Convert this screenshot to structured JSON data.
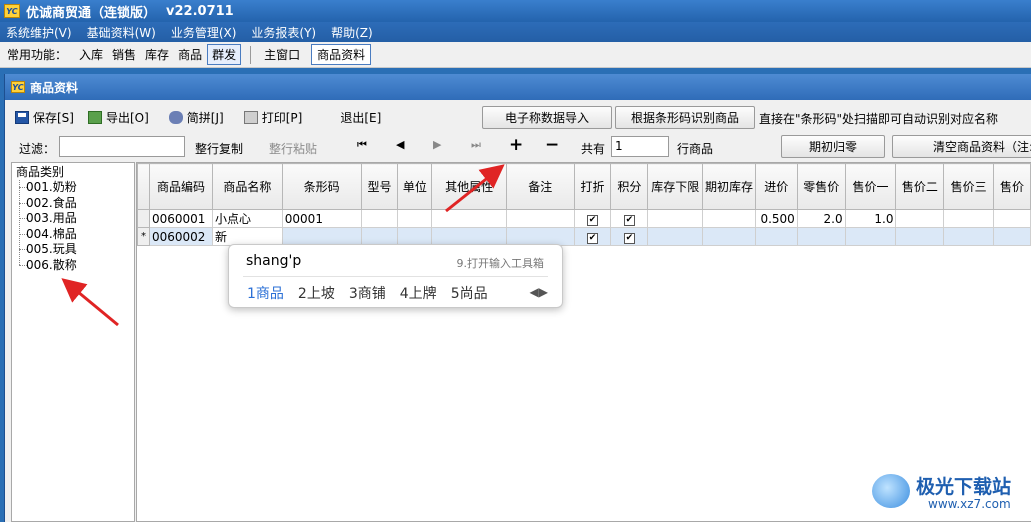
{
  "window": {
    "title": "优诚商贸通（连锁版）",
    "version": "v22.0711"
  },
  "menu": [
    "系统维护(V)",
    "基础资料(W)",
    "业务管理(X)",
    "业务报表(Y)",
    "帮助(Z)"
  ],
  "funcbar": {
    "label": "常用功能：",
    "items": [
      "入库",
      "销售",
      "库存",
      "商品",
      "群发"
    ],
    "tabs": [
      "主窗口",
      "商品资料"
    ]
  },
  "inner": {
    "title": "商品资料"
  },
  "toolbar": {
    "save": "保存[S]",
    "export": "导出[O]",
    "pinyin": "简拼[J]",
    "print": "打印[P]",
    "exit": "退出[E]",
    "import_scale": "电子称数据导入",
    "barcode_identify": "根据条形码识别商品",
    "hint": "直接在\"条形码\"处扫描即可自动识别对应名称"
  },
  "filter": {
    "label": "过滤：",
    "copy_row": "整行复制",
    "paste_row": "整行粘贴",
    "nav": {
      "first": "⏮",
      "prev": "◀",
      "next": "▶",
      "last": "⏭",
      "add": "+",
      "remove": "−"
    },
    "total_prefix": "共有",
    "total_value": "1",
    "total_suffix": "行商品",
    "reset_btn": "期初归零",
    "clear_btn": "清空商品资料（注:"
  },
  "tree": {
    "root": "商品类别",
    "nodes": [
      "001.奶粉",
      "002.食品",
      "003.用品",
      "004.棉品",
      "005.玩具",
      "006.散称"
    ]
  },
  "grid": {
    "columns": [
      "商品编码",
      "商品名称",
      "条形码",
      "型号",
      "单位",
      "其他属性",
      "备注",
      "打折",
      "积分",
      "库存下限",
      "期初库存",
      "进价",
      "零售价",
      "售价一",
      "售价二",
      "售价三",
      "售价"
    ],
    "rows": [
      {
        "indicator": "",
        "code": "0060001",
        "name": "小点心",
        "barcode": "00001",
        "discount": "✔",
        "points": "✔",
        "cost": "0.500",
        "retail": "2.0",
        "price1": "1.0"
      },
      {
        "indicator": "*",
        "code": "0060002",
        "name": "新",
        "barcode": "",
        "discount": "✔",
        "points": "✔",
        "cost": "",
        "retail": "",
        "price1": ""
      }
    ]
  },
  "ime": {
    "composition": "shang'p",
    "toolbox_hint": "9.打开输入工具箱",
    "candidates": [
      "1商品",
      "2上坡",
      "3商铺",
      "4上牌",
      "5尚品"
    ],
    "arrows": "◀▶"
  },
  "watermark": {
    "name": "极光下载站",
    "url": "www.xz7.com"
  }
}
